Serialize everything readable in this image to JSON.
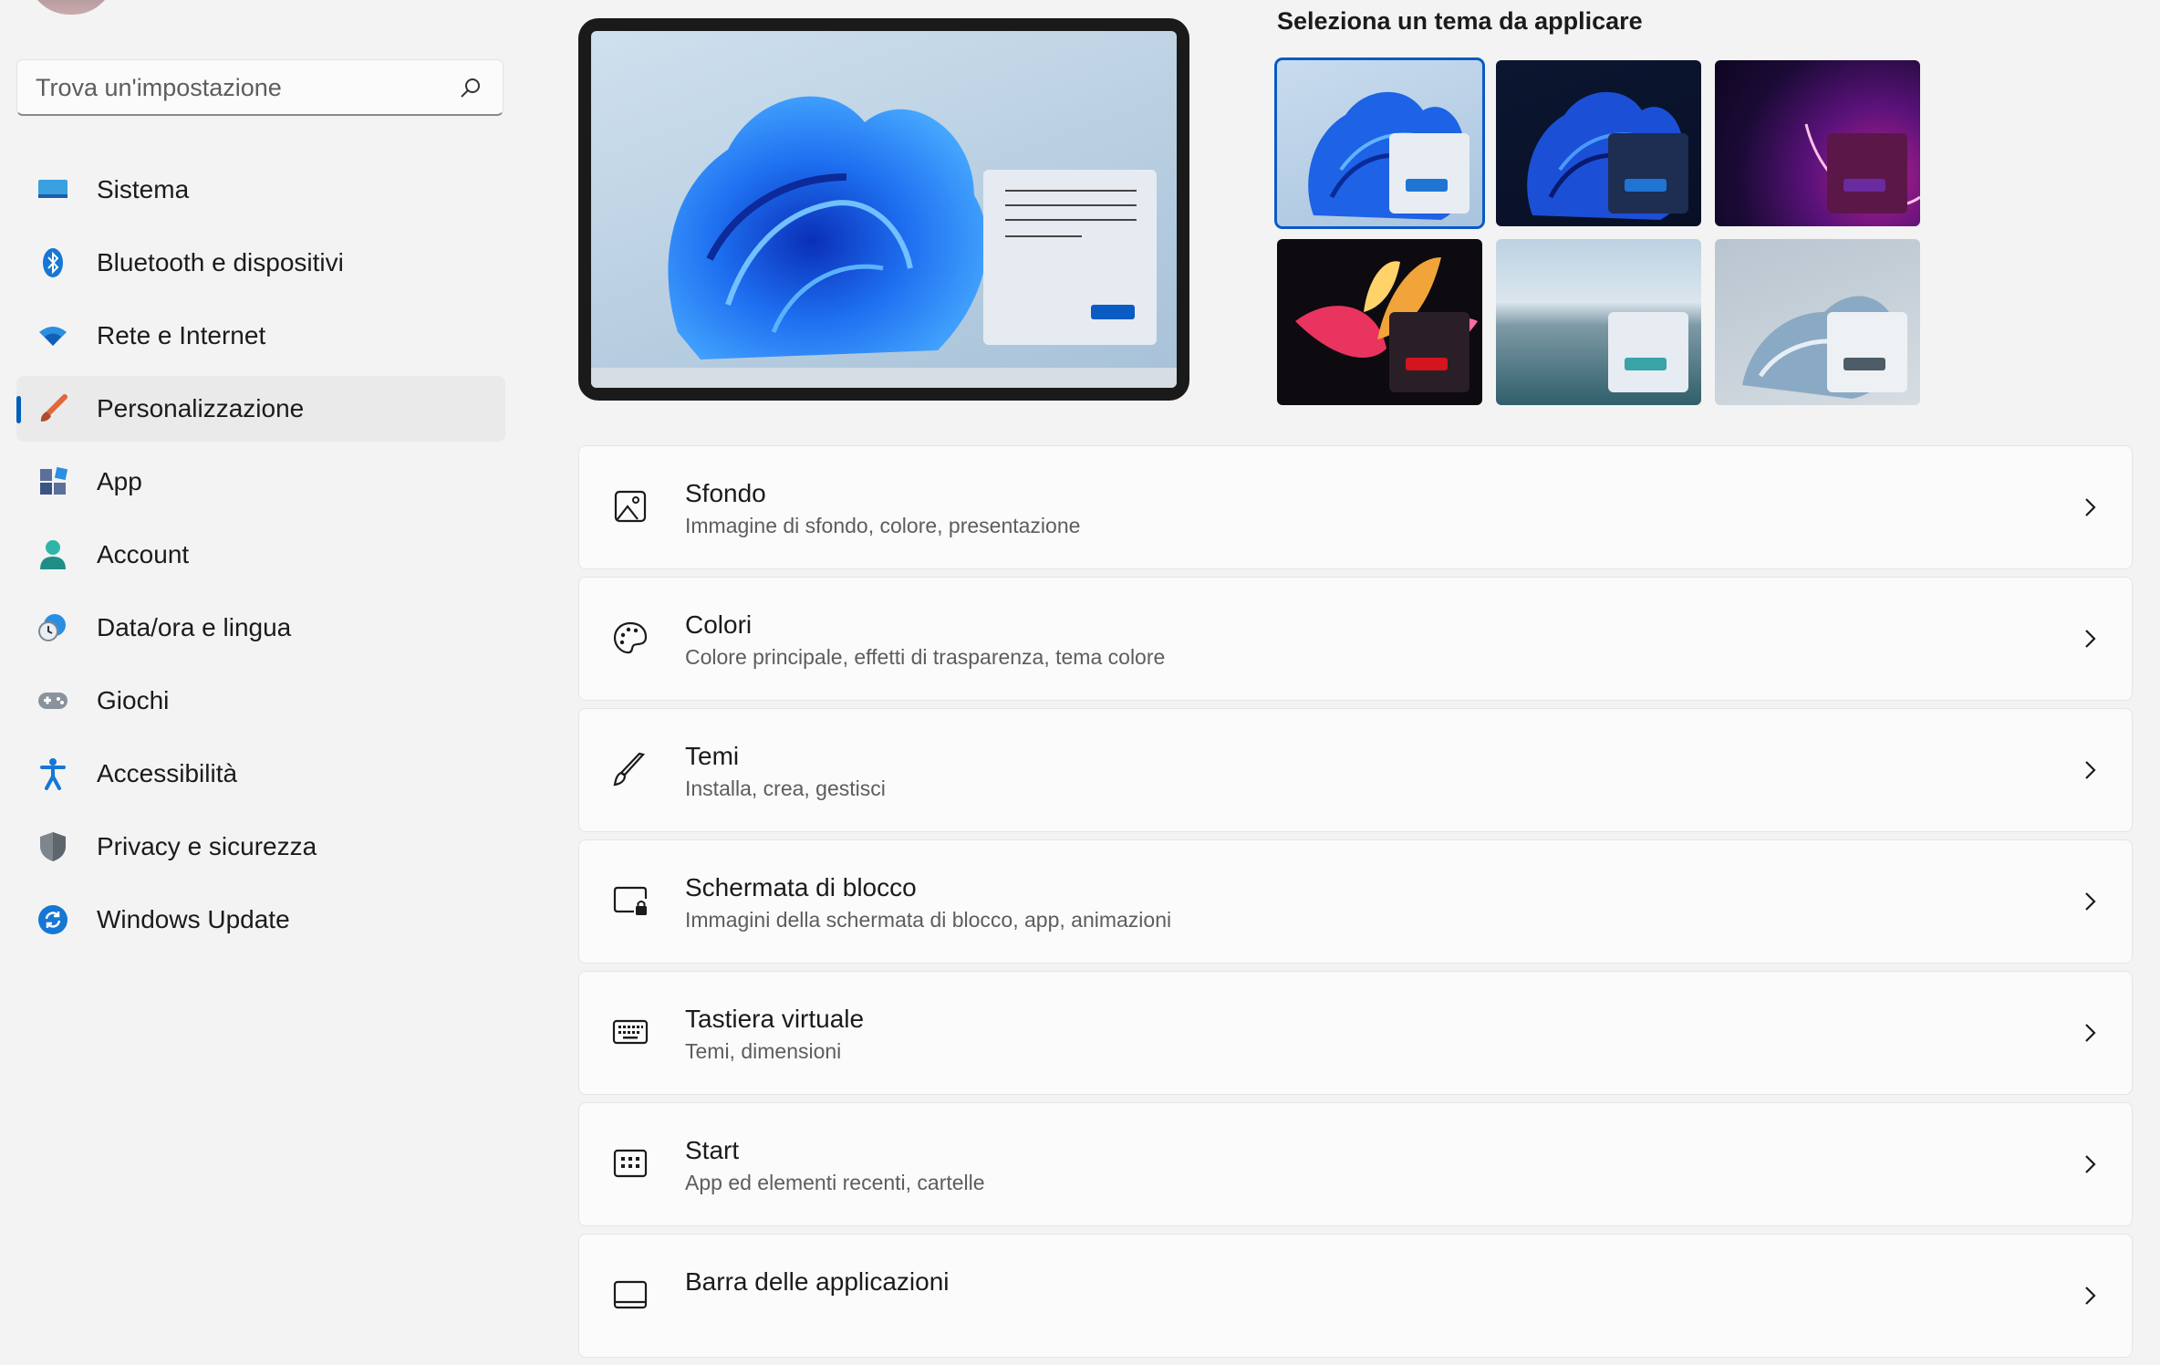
{
  "search": {
    "placeholder": "Trova un'impostazione",
    "icon": "search-icon"
  },
  "sidebar": {
    "items": [
      {
        "label": "Sistema",
        "icon": "system-icon",
        "active": false
      },
      {
        "label": "Bluetooth e dispositivi",
        "icon": "bluetooth-icon",
        "active": false
      },
      {
        "label": "Rete e Internet",
        "icon": "wifi-icon",
        "active": false
      },
      {
        "label": "Personalizzazione",
        "icon": "brush-icon",
        "active": true
      },
      {
        "label": "App",
        "icon": "apps-icon",
        "active": false
      },
      {
        "label": "Account",
        "icon": "account-icon",
        "active": false
      },
      {
        "label": "Data/ora e lingua",
        "icon": "clock-globe-icon",
        "active": false
      },
      {
        "label": "Giochi",
        "icon": "gamepad-icon",
        "active": false
      },
      {
        "label": "Accessibilità",
        "icon": "accessibility-icon",
        "active": false
      },
      {
        "label": "Privacy e sicurezza",
        "icon": "shield-icon",
        "active": false
      },
      {
        "label": "Windows Update",
        "icon": "update-icon",
        "active": false
      }
    ]
  },
  "themes": {
    "title": "Seleziona un tema da applicare",
    "items": [
      {
        "name": "windows-light",
        "selected": true
      },
      {
        "name": "windows-dark",
        "selected": false
      },
      {
        "name": "glow",
        "selected": false
      },
      {
        "name": "captured-motion",
        "selected": false
      },
      {
        "name": "sunrise",
        "selected": false
      },
      {
        "name": "flow",
        "selected": false
      }
    ]
  },
  "settings": [
    {
      "title": "Sfondo",
      "subtitle": "Immagine di sfondo, colore, presentazione",
      "icon": "image-icon"
    },
    {
      "title": "Colori",
      "subtitle": "Colore principale, effetti di trasparenza, tema colore",
      "icon": "palette-icon"
    },
    {
      "title": "Temi",
      "subtitle": "Installa, crea, gestisci",
      "icon": "pen-icon"
    },
    {
      "title": "Schermata di blocco",
      "subtitle": "Immagini della schermata di blocco, app, animazioni",
      "icon": "lock-screen-icon"
    },
    {
      "title": "Tastiera virtuale",
      "subtitle": "Temi, dimensioni",
      "icon": "keyboard-icon"
    },
    {
      "title": "Start",
      "subtitle": "App ed elementi recenti, cartelle",
      "icon": "start-icon"
    },
    {
      "title": "Barra delle applicazioni",
      "subtitle": "",
      "icon": "taskbar-icon"
    }
  ],
  "colors": {
    "accent": "#005fb8",
    "background": "#f3f3f3",
    "card": "#fbfbfb"
  }
}
